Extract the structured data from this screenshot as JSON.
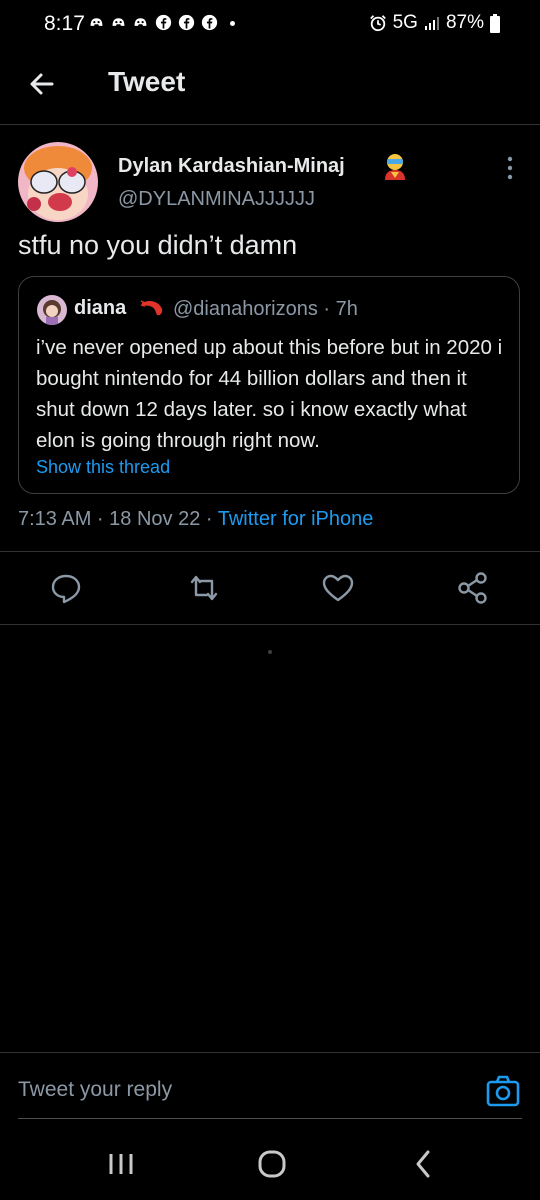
{
  "status_bar": {
    "time": "8:17",
    "network": "5G",
    "battery": "87%",
    "icons": [
      "discord-icon",
      "discord-icon",
      "discord-icon",
      "facebook-icon",
      "facebook-icon",
      "facebook-icon",
      "dot-icon",
      "alarm-icon",
      "signal-icon",
      "battery-icon"
    ]
  },
  "header": {
    "title": "Tweet",
    "back_icon": "arrow-left-icon"
  },
  "tweet": {
    "author_name": "Dylan Kardashian-Minaj",
    "author_handle": "@DYLANMINAJJJJJJ",
    "author_emoji": "superhero-emoji",
    "text": "stfu no you didn’t damn",
    "more_icon": "more-vertical-icon",
    "timestamp": "7:13 AM · 18 Nov 22 · ",
    "source": "Twitter for iPhone"
  },
  "quoted_tweet": {
    "author_name": "diana",
    "author_handle": "@dianahorizons · 7h",
    "author_emoji": "shrimp-emoji",
    "text": "i’ve never opened up about this before but in 2020 i bought nintendo for 44 billion dollars and then it shut down 12 days later. so i know exactly what elon is going through right now.",
    "show_thread": "Show this thread"
  },
  "actions": [
    {
      "name": "reply",
      "icon": "comment-icon"
    },
    {
      "name": "retweet",
      "icon": "retweet-icon"
    },
    {
      "name": "like",
      "icon": "heart-icon"
    },
    {
      "name": "share",
      "icon": "share-icon"
    }
  ],
  "reply_bar": {
    "placeholder": "Tweet your reply",
    "camera_icon": "camera-icon"
  },
  "nav_bar": {
    "buttons": [
      "recents-icon",
      "home-icon",
      "back-icon"
    ]
  },
  "colors": {
    "background": "#000000",
    "text": "#e7e9ea",
    "secondary_text": "#8b98a5",
    "accent": "#1d9bf0",
    "divider": "#2f3336"
  }
}
